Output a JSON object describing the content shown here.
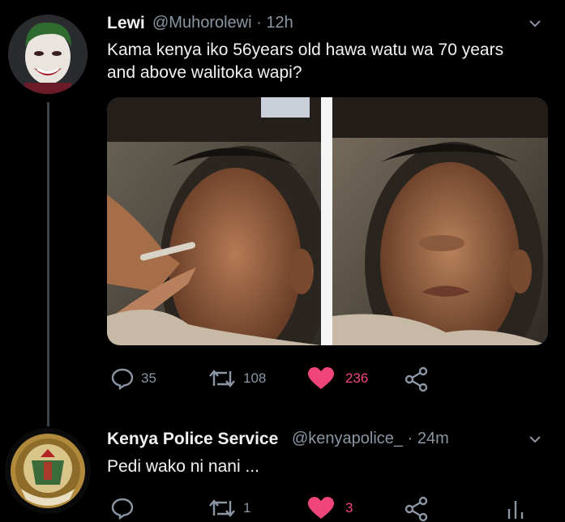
{
  "tweet1": {
    "author": "Lewi",
    "handle_time": "@Muhorolewi · 12h",
    "text": "Kama kenya iko 56years old hawa watu wa 70 years\nand above walitoka wapi?",
    "stats": {
      "replies": "35",
      "retweets": "108",
      "likes": "236"
    }
  },
  "tweet2": {
    "author": "Kenya Police Service",
    "handle_time": "@kenyapolice_ · 24m",
    "text": "Pedi wako ni nani ...",
    "stats": {
      "retweets": "1",
      "likes": "3"
    }
  },
  "colors": {
    "background": "#000000",
    "muted": "#8a96a3",
    "like": "#f0457a",
    "thread_line": "#38444d"
  },
  "icons": [
    "reply-icon",
    "retweet-icon",
    "heart-icon",
    "share-icon",
    "chevron-down-icon",
    "analytics-icon"
  ]
}
